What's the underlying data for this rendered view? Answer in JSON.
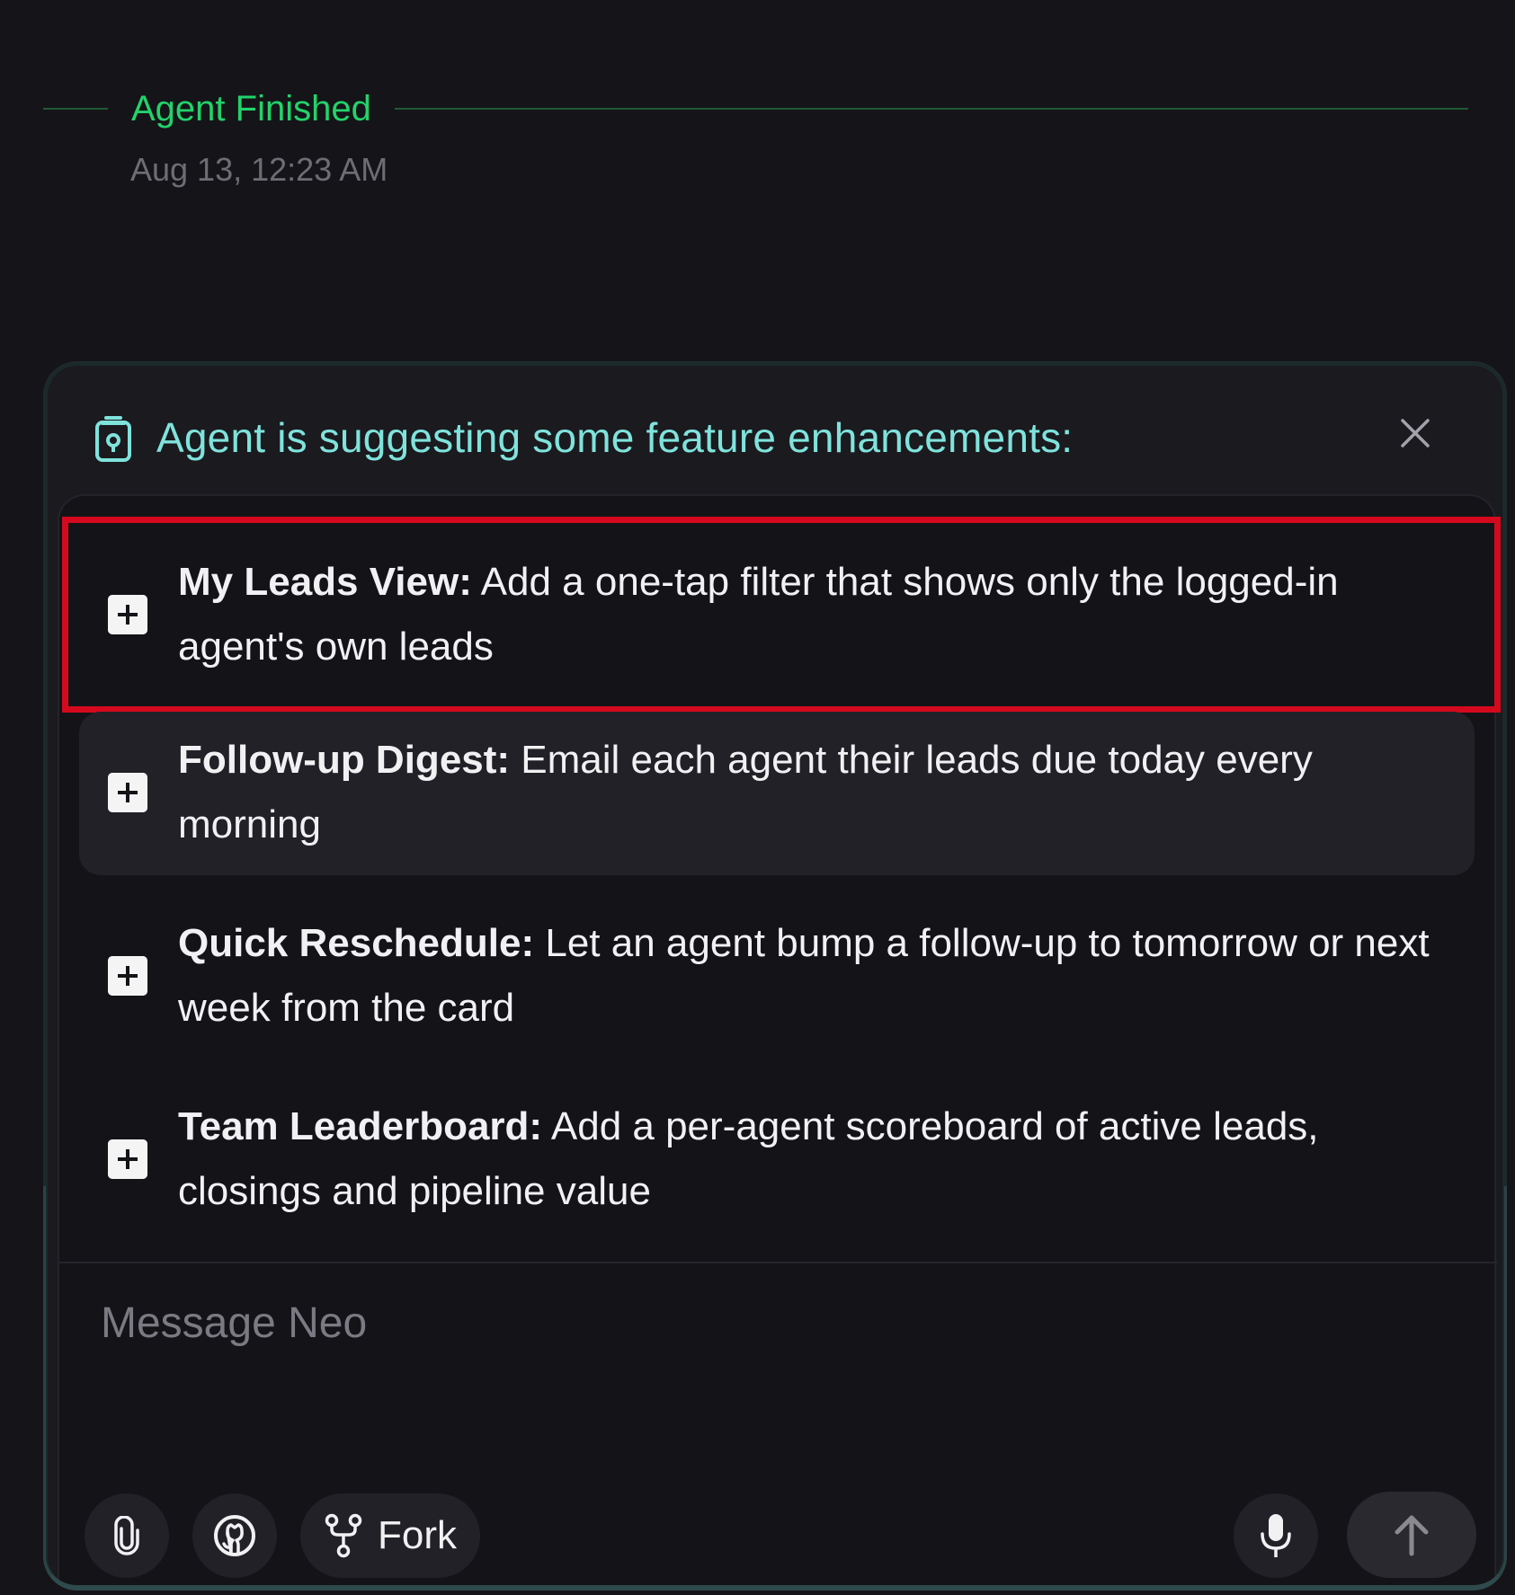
{
  "status": {
    "title": "Agent Finished",
    "timestamp": "Aug 13, 12:23 AM",
    "accent_color": "#22d36a"
  },
  "suggestions_panel": {
    "title": "Agent is suggesting some feature enhancements:",
    "title_color": "#7fe3dc",
    "icon": "clipboard-lock-icon",
    "close_icon": "close-icon",
    "items": [
      {
        "name": "My Leads View:",
        "description": " Add a one-tap filter that shows only the logged-in agent's own leads",
        "state": "selected"
      },
      {
        "name": "Follow-up Digest:",
        "description": " Email each agent their leads due today every morning",
        "state": "hover"
      },
      {
        "name": "Quick Reschedule:",
        "description": " Let an agent bump a follow-up to tomorrow or next week from the card",
        "state": "default"
      },
      {
        "name": "Team Leaderboard:",
        "description": " Add a per-agent scoreboard of active leads, closings and pipeline value",
        "state": "default"
      }
    ],
    "selection_color": "#d5091d"
  },
  "composer": {
    "placeholder": "Message Neo",
    "value": "",
    "toolbar": {
      "attach_icon": "paperclip-icon",
      "github_icon": "github-icon",
      "fork_icon": "fork-icon",
      "fork_label": "Fork",
      "mic_icon": "microphone-icon",
      "send_icon": "arrow-up-icon"
    }
  }
}
